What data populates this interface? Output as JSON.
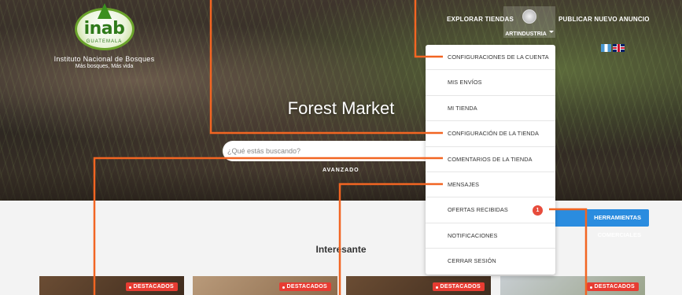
{
  "header": {
    "org_name": "Instituto Nacional de Bosques",
    "slogan": "Más bosques, Más vida",
    "logo_text": "inab",
    "logo_subtext": "GUATEMALA",
    "nav_explore": "EXPLORAR TIENDAS",
    "user_name": "ARTINDUSTRIA",
    "nav_publish": "PUBLICAR NUEVO ANUNCIO",
    "languages": [
      "Guatemala flag",
      "UK flag"
    ]
  },
  "hero": {
    "title": "Forest Market",
    "search_placeholder": "¿Qué estás buscando?",
    "advanced_label": "AVANZADO"
  },
  "dropdown": {
    "items": [
      {
        "label": "CONFIGURACIONES DE LA CUENTA"
      },
      {
        "label": "MIS ENVÍOS"
      },
      {
        "label": "MI TIENDA"
      },
      {
        "label": "CONFIGURACIÓN DE LA TIENDA"
      },
      {
        "label": "COMENTARIOS DE LA TIENDA"
      },
      {
        "label": "MENSAJES"
      },
      {
        "label": "OFERTAS RECIBIDAS",
        "count": "1"
      },
      {
        "label": "NOTIFICACIONES"
      },
      {
        "label": "CERRAR SESIÓN"
      }
    ]
  },
  "tools_button": "HERRAMIENTAS COMERCIALES",
  "section": {
    "title": "Interesante",
    "cards": [
      {
        "badge": "DESTACADOS"
      },
      {
        "badge": "DESTACADOS"
      },
      {
        "badge": "DESTACADOS"
      },
      {
        "badge": "DESTACADOS"
      }
    ]
  },
  "colors": {
    "accent_callout": "#f26522",
    "badge_red": "#e73c32",
    "button_blue": "#2a8cdf"
  }
}
